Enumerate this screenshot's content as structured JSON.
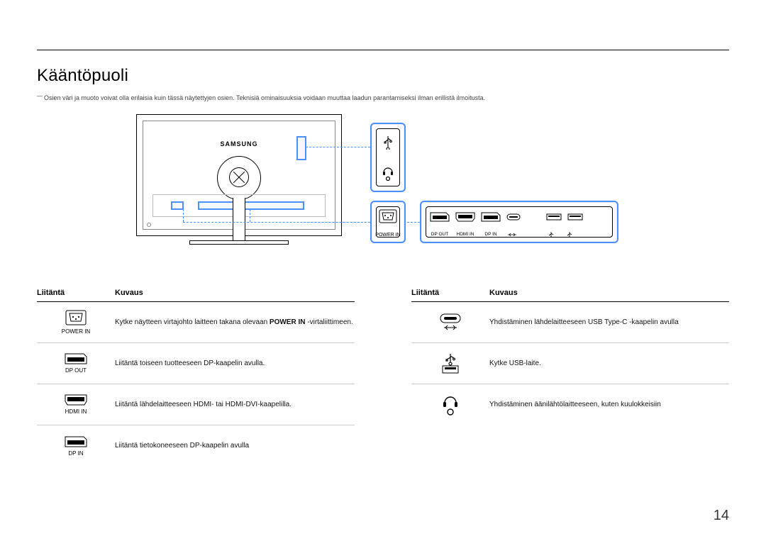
{
  "page": {
    "title": "Kääntöpuoli",
    "note": "Osien väri ja muoto voivat olla erilaisia kuin tässä näytettyjen osien. Teknisiä ominaisuuksia voidaan muuttaa laadun parantamiseksi ilman erillistä ilmoitusta.",
    "number": "14",
    "brand": "SAMSUNG"
  },
  "diagram_labels": {
    "power_in": "POWER IN",
    "dp_out": "DP OUT",
    "hdmi_in": "HDMI IN",
    "dp_in": "DP IN"
  },
  "table_headers": {
    "port": "Liitäntä",
    "desc": "Kuvaus"
  },
  "left_rows": [
    {
      "label": "POWER IN",
      "desc_pre": "Kytke näytteen virtajohto laitteen takana olevaan ",
      "desc_bold": "POWER IN",
      "desc_post": " -virtaliittimeen."
    },
    {
      "label": "DP OUT",
      "desc": "Liitäntä toiseen tuotteeseen DP-kaapelin avulla."
    },
    {
      "label": "HDMI IN",
      "desc": "Liitäntä lähdelaitteeseen HDMI- tai HDMI-DVI-kaapelilla."
    },
    {
      "label": "DP IN",
      "desc": "Liitäntä tietokoneeseen DP-kaapelin avulla"
    }
  ],
  "right_rows": [
    {
      "label": "",
      "desc": "Yhdistäminen lähdelaitteeseen USB Type-C -kaapelin avulla"
    },
    {
      "label": "",
      "desc": "Kytke USB-laite."
    },
    {
      "label": "",
      "desc": "Yhdistäminen äänilähtölaitteeseen, kuten kuulokkeisiin"
    }
  ]
}
